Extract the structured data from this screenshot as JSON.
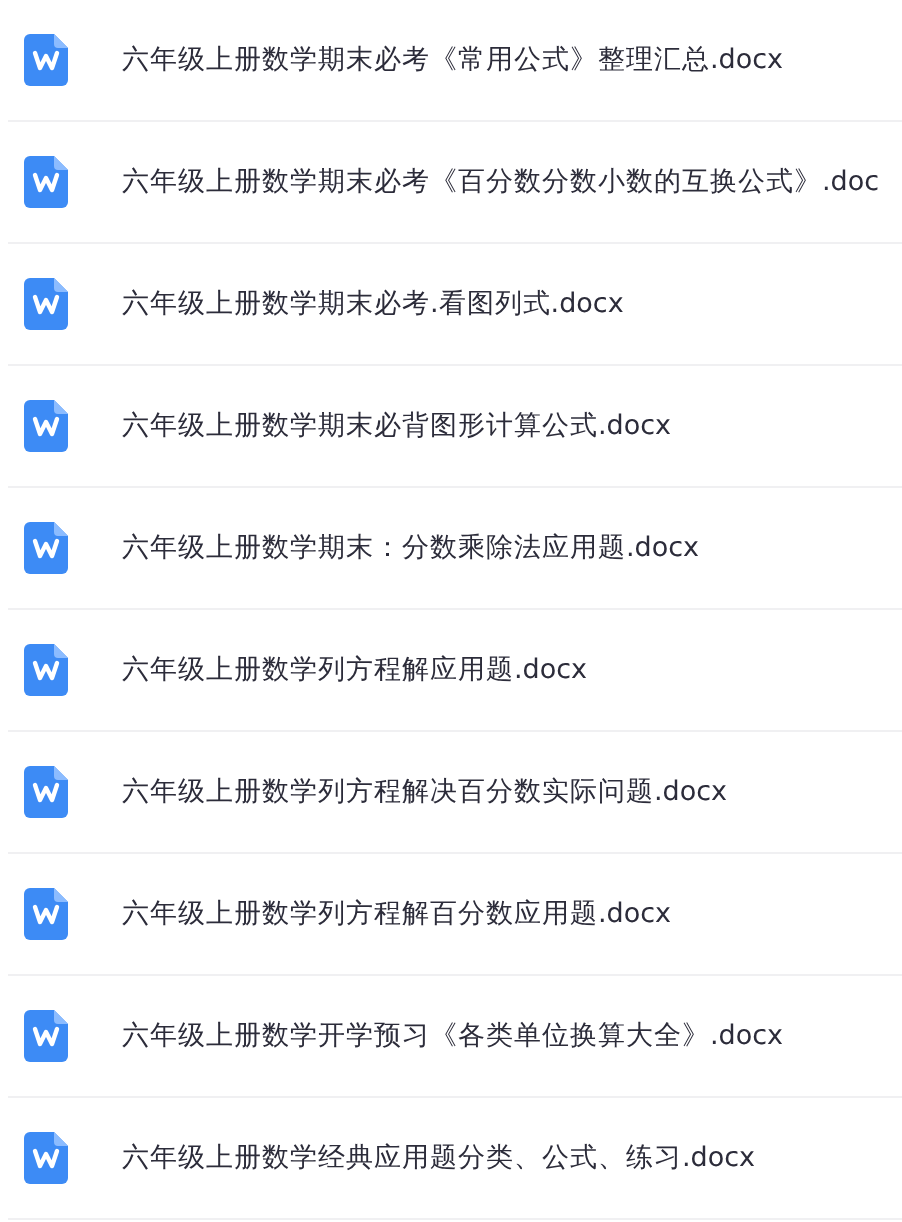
{
  "files": [
    {
      "name": "六年级上册数学期末必考《常用公式》整理汇总.docx"
    },
    {
      "name": "六年级上册数学期末必考《百分数分数小数的互换公式》.doc"
    },
    {
      "name": "六年级上册数学期末必考.看图列式.docx"
    },
    {
      "name": "六年级上册数学期末必背图形计算公式.docx"
    },
    {
      "name": "六年级上册数学期末：分数乘除法应用题.docx"
    },
    {
      "name": "六年级上册数学列方程解应用题.docx"
    },
    {
      "name": "六年级上册数学列方程解决百分数实际问题.docx"
    },
    {
      "name": "六年级上册数学列方程解百分数应用题.docx"
    },
    {
      "name": "六年级上册数学开学预习《各类单位换算大全》.docx"
    },
    {
      "name": "六年级上册数学经典应用题分类、公式、练习.docx"
    }
  ]
}
